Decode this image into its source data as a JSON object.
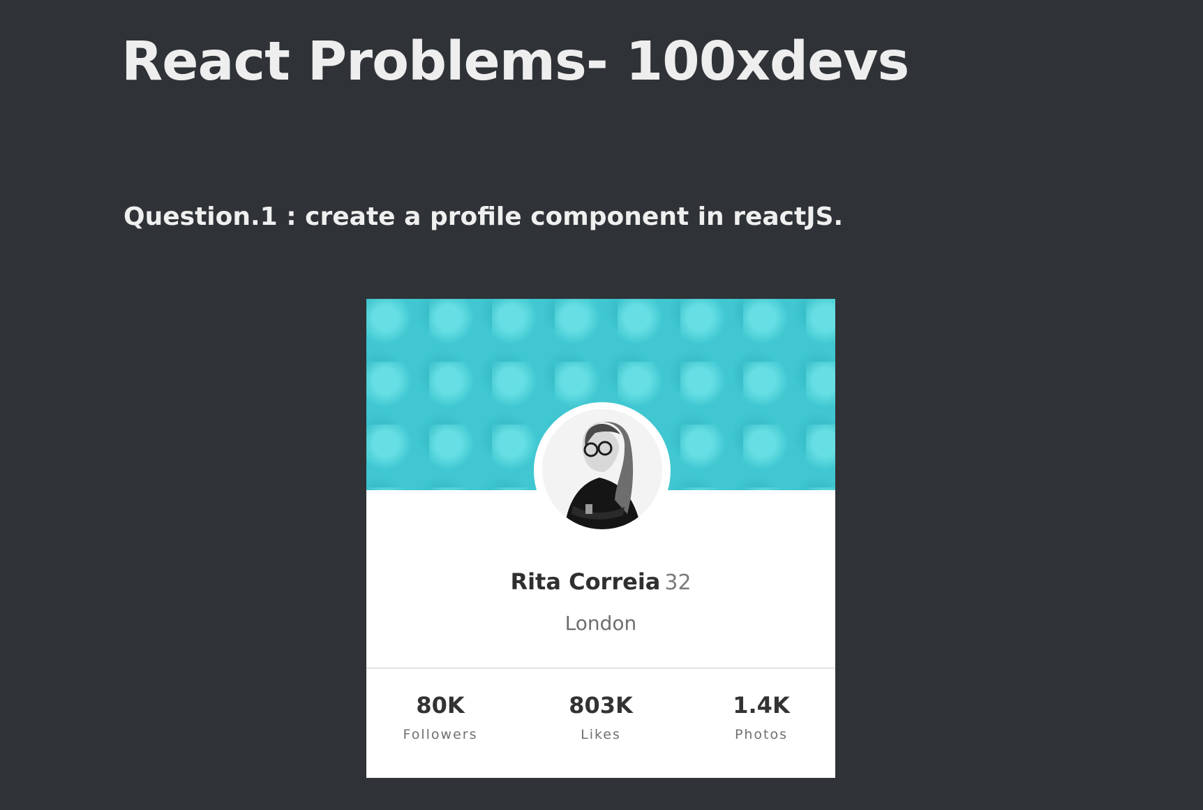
{
  "page": {
    "title": "React Problems- 100xdevs",
    "question": "Question.1 : create a profile component in reactJS."
  },
  "profile": {
    "name": "Rita Correia",
    "age": "32",
    "city": "London",
    "stats": [
      {
        "value": "80K",
        "label": "Followers"
      },
      {
        "value": "803K",
        "label": "Likes"
      },
      {
        "value": "1.4K",
        "label": "Photos"
      }
    ]
  },
  "colors": {
    "background": "#2f3337",
    "banner": "#40c7d1",
    "card": "#ffffff"
  }
}
